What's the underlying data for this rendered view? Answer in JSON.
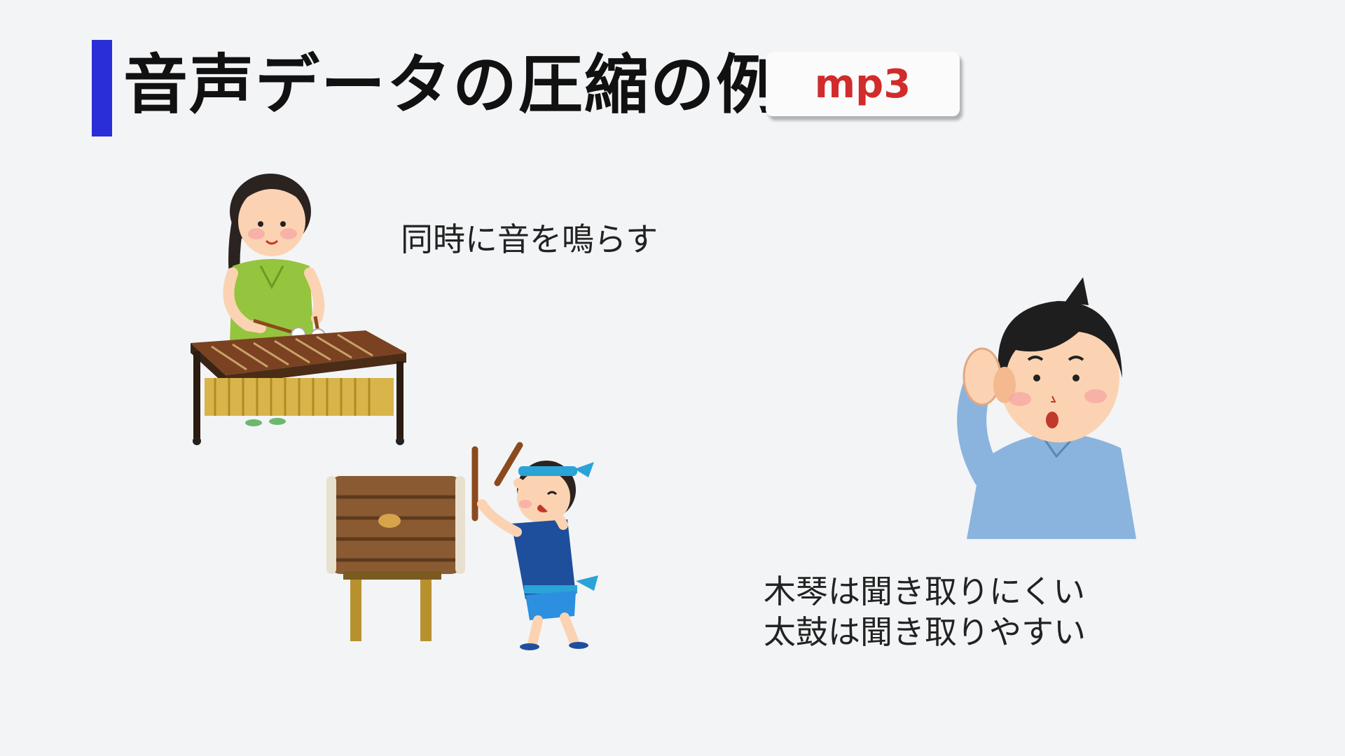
{
  "slide": {
    "title": "音声データの圧縮の例",
    "badge": "mp3",
    "caption_simultaneous": "同時に音を鳴らす",
    "caption_result_line1": "木琴は聞き取りにくい",
    "caption_result_line2": "太鼓は聞き取りやすい"
  },
  "colors": {
    "accent": "#2a2ed6",
    "badge_text": "#d12b2b",
    "background": "#f3f4f6"
  },
  "illustrations": [
    {
      "name": "xylophone-player",
      "icon": "woman-playing-xylophone"
    },
    {
      "name": "taiko-drummer",
      "icon": "boy-playing-taiko-drum"
    },
    {
      "name": "listener",
      "icon": "man-cupping-ear"
    }
  ]
}
